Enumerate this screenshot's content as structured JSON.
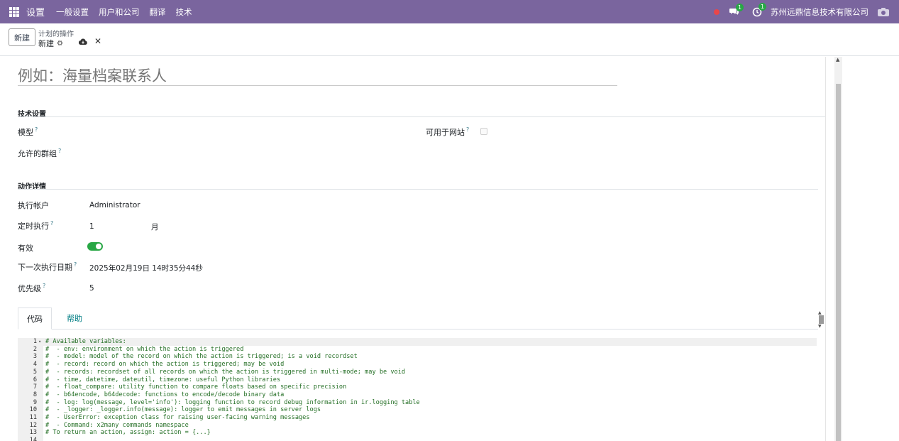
{
  "navbar": {
    "brand": "设置",
    "menu": [
      "一般设置",
      "用户和公司",
      "翻译",
      "技术"
    ],
    "chat_badge": "1",
    "activity_badge": "1",
    "company": "苏州远鼎信息技术有限公司",
    "colors": {
      "bar": "#7a659e",
      "badge": "#28a745"
    }
  },
  "control": {
    "new_button": "新建",
    "breadcrumb_parent": "计划的操作",
    "breadcrumb_current": "新建"
  },
  "form": {
    "name_placeholder": "例如：海量档案联系人",
    "tech_section": "技术设置",
    "model_label": "模型",
    "website_label": "可用于网站",
    "groups_label": "允许的群组",
    "action_section": "动作详情",
    "user_label": "执行帐户",
    "user_value": "Administrator",
    "interval_label": "定时执行",
    "interval_number": "1",
    "interval_unit": "月",
    "active_label": "有效",
    "active_value": true,
    "nextcall_label": "下一次执行日期",
    "nextcall_value": "2025年02月19日 14时35分44秒",
    "priority_label": "优先级",
    "priority_value": "5",
    "help_mark": "?"
  },
  "tabs": {
    "code": "代码",
    "help": "帮助"
  },
  "code_lines": [
    "# Available variables:",
    "#  - env: environment on which the action is triggered",
    "#  - model: model of the record on which the action is triggered; is a void recordset",
    "#  - record: record on which the action is triggered; may be void",
    "#  - records: recordset of all records on which the action is triggered in multi-mode; may be void",
    "#  - time, datetime, dateutil, timezone: useful Python libraries",
    "#  - float_compare: utility function to compare floats based on specific precision",
    "#  - b64encode, b64decode: functions to encode/decode binary data",
    "#  - log: log(message, level='info'): logging function to record debug information in ir.logging table",
    "#  - _logger: _logger.info(message): logger to emit messages in server logs",
    "#  - UserError: exception class for raising user-facing warning messages",
    "#  - Command: x2many commands namespace",
    "# To return an action, assign: action = {...}",
    ""
  ]
}
